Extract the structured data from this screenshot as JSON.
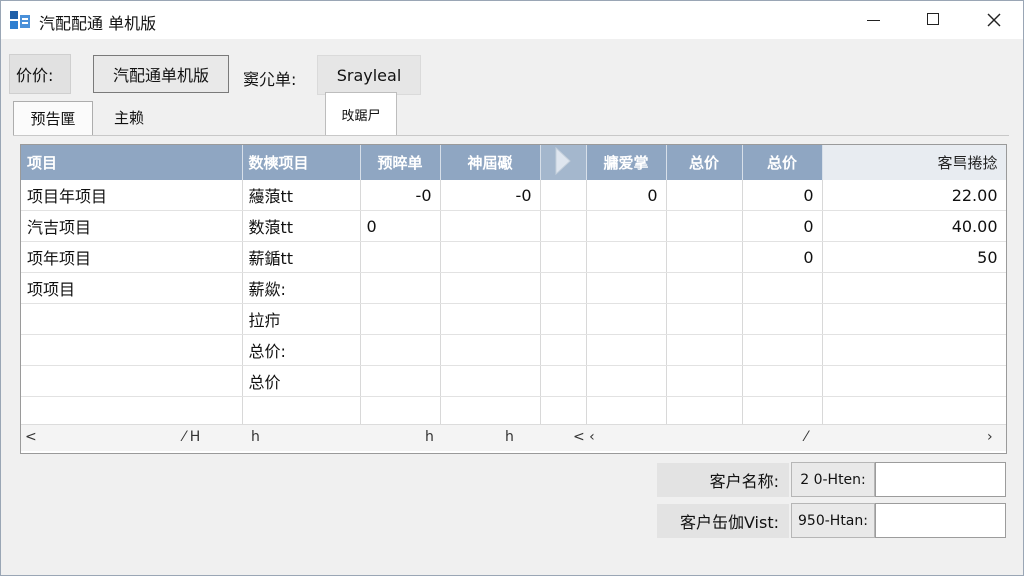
{
  "window": {
    "title": "汽配配通 单机版"
  },
  "toolbar": {
    "price_label": "价价:",
    "mode_button": "汽配通单机版",
    "dept_label": "窦尣单:",
    "customer_value": "Srayleal"
  },
  "tabs": [
    {
      "label": "预告匰"
    },
    {
      "label": "主赖"
    },
    {
      "label": "攺踞尸"
    }
  ],
  "grid": {
    "columns": [
      "项目",
      "数樉项目",
      "预晬单",
      "神屆礟",
      "",
      "牅爱掌",
      "总价",
      "总价",
      "客巪捲捻"
    ],
    "rows": [
      [
        "项目年项目",
        "蘰蒗tt",
        "-0",
        "-0",
        "",
        "0",
        "",
        "0",
        "22.00"
      ],
      [
        "汽吉项目",
        "数蒗tt",
        "0",
        "",
        "",
        "",
        "",
        "0",
        "40.00"
      ],
      [
        "项年项目",
        "薪鍎tt",
        "",
        "",
        "",
        "",
        "",
        "0",
        "50"
      ],
      [
        "项项目",
        "薪歘:",
        "",
        "",
        "",
        "",
        "",
        "",
        ""
      ],
      [
        "",
        "拉疖",
        "",
        "",
        "",
        "",
        "",
        "",
        ""
      ],
      [
        "",
        "总价:",
        "",
        "",
        "",
        "",
        "",
        "",
        ""
      ],
      [
        "",
        "总价",
        "",
        "",
        "",
        "",
        "",
        "",
        ""
      ],
      [
        "",
        "",
        "",
        "",
        "",
        "",
        "",
        "",
        ""
      ]
    ],
    "scroll_marks": [
      "<",
      "⁄ H",
      "h",
      "h",
      "h",
      "< ‹",
      "⁄",
      "›"
    ]
  },
  "bottom_fields": [
    {
      "label": "客户名称:",
      "code": "2 0-Hten:"
    },
    {
      "label": "客户缶伽Vist:",
      "code": "950-Htan:"
    }
  ]
}
